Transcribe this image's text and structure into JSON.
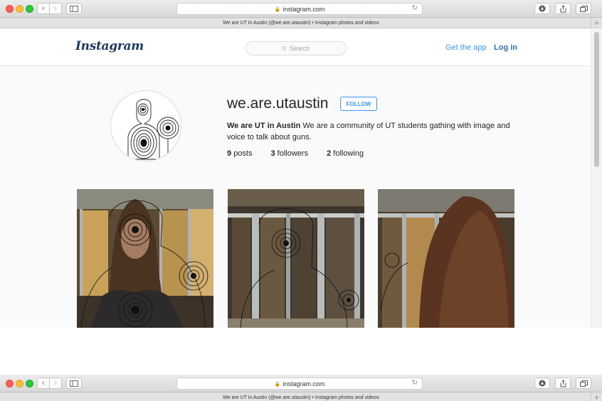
{
  "browser": {
    "url": "instagram.com",
    "tab_title": "We are UT in Austin (@we.are.utaustin) • Instagram photos and videos"
  },
  "header": {
    "logo": "Instagram",
    "search_placeholder": "Search",
    "get_app": "Get the app",
    "login": "Log in"
  },
  "profile": {
    "username": "we.are.utaustin",
    "follow_label": "FOLLOW",
    "full_name": "We are UT in Austin",
    "bio": "We are a community of UT students gathing with image and voice to talk about guns.",
    "stats": {
      "posts_count": "9",
      "posts_label": "posts",
      "followers_count": "3",
      "followers_label": "followers",
      "following_count": "2",
      "following_label": "following"
    }
  },
  "colors": {
    "link_blue": "#3897f0",
    "logo_navy": "#1c3a5d"
  }
}
